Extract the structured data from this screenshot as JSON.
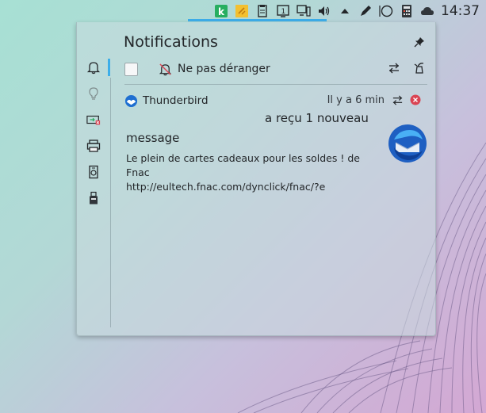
{
  "tray": {
    "clock": "14:37",
    "icons": [
      "k-app-icon",
      "sticky-notes-icon",
      "clipboard-icon",
      "virtual-desktop-icon",
      "display-icon",
      "volume-icon",
      "expand-arrow-icon",
      "pen-icon",
      "circle-icon",
      "calculator-icon",
      "weather-icon"
    ],
    "virtual_desktop_number": "1"
  },
  "panel": {
    "title": "Notifications",
    "side_tabs": [
      "notifications-tab",
      "lightbulb-tab",
      "battery-tab",
      "printer-tab",
      "device-tab",
      "usb-tab"
    ]
  },
  "dnd": {
    "label": "Ne pas déranger",
    "checked": false
  },
  "notification": {
    "app_name": "Thunderbird",
    "time": "Il y a 6 min",
    "summary_line1": "a reçu 1 nouveau",
    "summary_line2": "message",
    "body_line1": "Le plein de cartes cadeaux pour les soldes ! de Fnac",
    "body_line2": "http://eultech.fnac.com/dynclick/fnac/?e"
  },
  "colors": {
    "accent": "#3daee9",
    "close": "#da4453"
  }
}
